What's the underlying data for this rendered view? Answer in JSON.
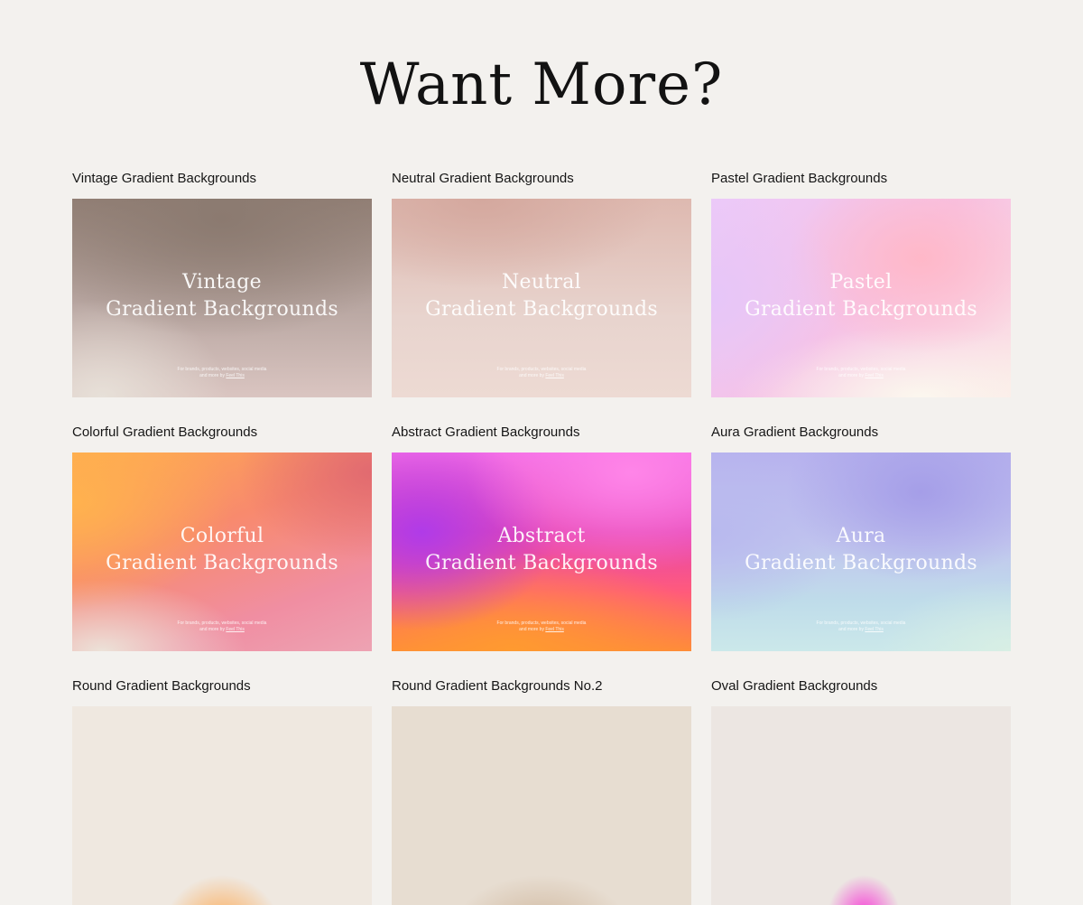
{
  "page": {
    "title": "Want More?"
  },
  "cards": [
    {
      "label": "Vintage Gradient Backgrounds",
      "thumb_title_line1": "Vintage",
      "thumb_title_line2": "Gradient Backgrounds",
      "caption_line1": "For brands, products, websites, social media",
      "caption_line2_prefix": "and more by",
      "caption_brand": "Feel This",
      "style": "vintage"
    },
    {
      "label": "Neutral Gradient Backgrounds",
      "thumb_title_line1": "Neutral",
      "thumb_title_line2": "Gradient Backgrounds",
      "caption_line1": "For brands, products, websites, social media",
      "caption_line2_prefix": "and more by",
      "caption_brand": "Feel This",
      "style": "neutral"
    },
    {
      "label": "Pastel Gradient Backgrounds",
      "thumb_title_line1": "Pastel",
      "thumb_title_line2": "Gradient Backgrounds",
      "caption_line1": "For brands, products, websites, social media",
      "caption_line2_prefix": "and more by",
      "caption_brand": "Feel This",
      "style": "pastel"
    },
    {
      "label": "Colorful Gradient Backgrounds",
      "thumb_title_line1": "Colorful",
      "thumb_title_line2": "Gradient Backgrounds",
      "caption_line1": "For brands, products, websites, social media",
      "caption_line2_prefix": "and more by",
      "caption_brand": "Feel This",
      "style": "colorful"
    },
    {
      "label": "Abstract Gradient Backgrounds",
      "thumb_title_line1": "Abstract",
      "thumb_title_line2": "Gradient Backgrounds",
      "caption_line1": "For brands, products, websites, social media",
      "caption_line2_prefix": "and more by",
      "caption_brand": "Feel This",
      "style": "abstract"
    },
    {
      "label": "Aura Gradient Backgrounds",
      "thumb_title_line1": "Aura",
      "thumb_title_line2": "Gradient Backgrounds",
      "caption_line1": "For brands, products, websites, social media",
      "caption_line2_prefix": "and more by",
      "caption_brand": "Feel This",
      "style": "aura"
    },
    {
      "label": "Round Gradient Backgrounds",
      "style": "round"
    },
    {
      "label": "Round Gradient Backgrounds No.2",
      "style": "round2"
    },
    {
      "label": "Oval Gradient Backgrounds",
      "style": "oval"
    }
  ],
  "colors": {
    "page_background": "#f3f1ee",
    "title_text": "#121212",
    "label_text": "#161616"
  }
}
